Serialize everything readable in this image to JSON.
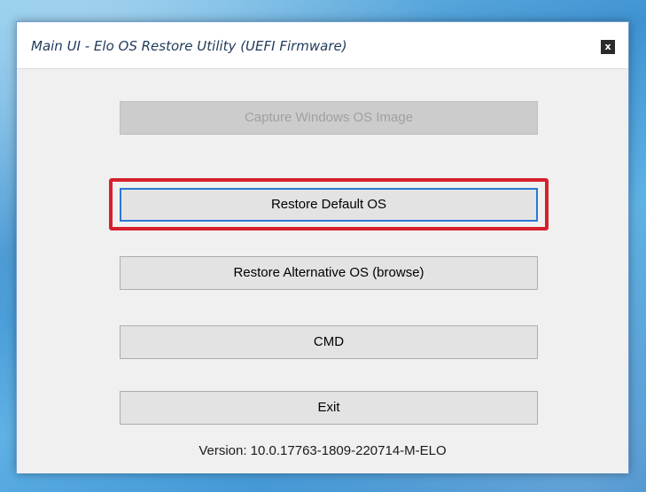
{
  "window": {
    "title": "Main UI - Elo OS Restore Utility (UEFI Firmware)",
    "close_glyph": "x"
  },
  "buttons": {
    "capture_label": "Capture Windows OS Image",
    "restore_default_label": "Restore Default OS",
    "restore_alternative_label": "Restore Alternative OS (browse)",
    "cmd_label": "CMD",
    "exit_label": "Exit"
  },
  "version": {
    "text": "Version: 10.0.17763-1809-220714-M-ELO"
  },
  "colors": {
    "highlight": "#d6202c",
    "focus_border": "#2a78d4",
    "client_background": "#f0f0f0"
  }
}
